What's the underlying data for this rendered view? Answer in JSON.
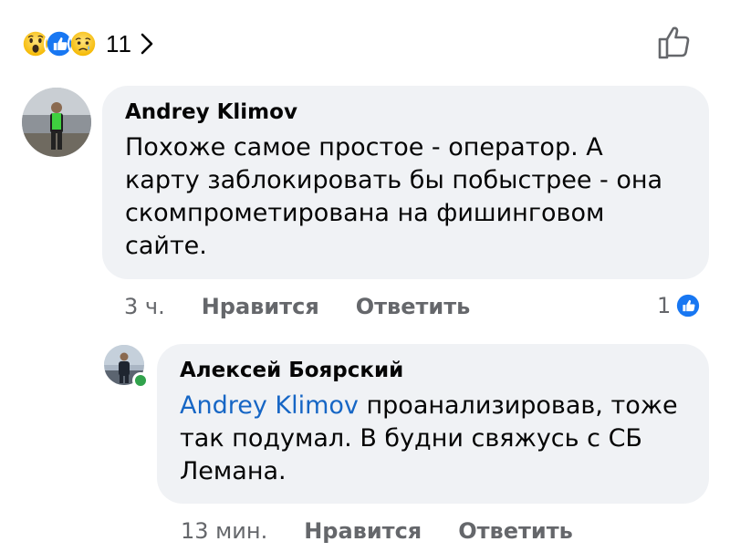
{
  "reactions": {
    "items": [
      {
        "type": "wow",
        "icon": "wow-emoji-icon"
      },
      {
        "type": "like",
        "icon": "like-reaction-icon"
      },
      {
        "type": "sad",
        "icon": "sad-emoji-icon"
      }
    ],
    "count": "11"
  },
  "comments": [
    {
      "author": "Andrey Klimov",
      "text": "Похоже самое простое - оператор. А\nкарту заблокировать бы побыстрее - она\nскомпрометирована на фишинговом\nсайте.",
      "time": "3 ч.",
      "like_label": "Нравится",
      "reply_label": "Ответить",
      "reaction_count": "1"
    },
    {
      "author": "Алексей Боярский",
      "mention": "Andrey Klimov",
      "text_after_mention": " проанализировав, тоже",
      "text_rest": "так подумал. В будни свяжусь с СБ\nЛемана.",
      "time": "13 мин.",
      "like_label": "Нравится",
      "reply_label": "Ответить",
      "online": true
    }
  ],
  "colors": {
    "bubble": "#f0f2f5",
    "meta_text": "#65676b",
    "mention": "#1666c5",
    "like_blue": "#1877f2",
    "online_green": "#31a24c"
  }
}
